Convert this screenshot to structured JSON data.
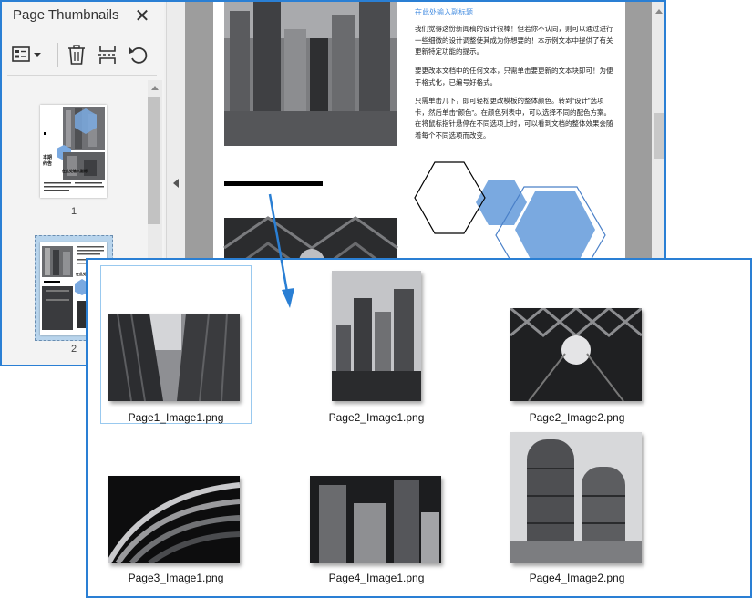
{
  "thumbnails_panel": {
    "title": "Page Thumbnails",
    "close_icon": "close-icon",
    "toolbar": {
      "options_icon": "thumbnail-options-icon",
      "delete_icon": "trash-icon",
      "extract_icon": "page-cut-icon",
      "rotate_icon": "rotate-icon"
    },
    "pages": [
      {
        "number": "1",
        "heading_a": "本期",
        "heading_b": "约告",
        "caption": "在此处输入副标"
      },
      {
        "number": "2",
        "caption": "在此处输入副标"
      }
    ]
  },
  "document": {
    "subtitle": "在此处输入副标题",
    "paragraphs": [
      "我们觉得这份新闻稿的设计很棒！但若你不认同，则可以通过进行一些细微的设计调整使其成为你想要的！本示例文本中提供了有关更新特定功能的提示。",
      "要更改本文档中的任何文本，只需单击要更新的文本块即可！为便于格式化，已编号好格式。",
      "只需单击几下，即可轻松更改模板的整体颜色。转到“设计”选项卡，然后单击“颜色”。在颜色列表中，可以选择不同的配色方案。在将鼠标指针悬停在不同选项上时，可以看到文档的整体效果会随着每个不同选项而改变。"
    ]
  },
  "extracted_images": [
    {
      "filename": "Page1_Image1.png",
      "selected": true
    },
    {
      "filename": "Page2_Image1.png",
      "selected": false
    },
    {
      "filename": "Page2_Image2.png",
      "selected": false
    },
    {
      "filename": "Page3_Image1.png",
      "selected": false
    },
    {
      "filename": "Page4_Image1.png",
      "selected": false
    },
    {
      "filename": "Page4_Image2.png",
      "selected": false
    }
  ],
  "colors": {
    "window_border": "#2a7fd4",
    "hexagon_fill": "#7aa9e0",
    "subtitle_blue": "#4a90e2",
    "selection_border": "#99c9ef"
  }
}
